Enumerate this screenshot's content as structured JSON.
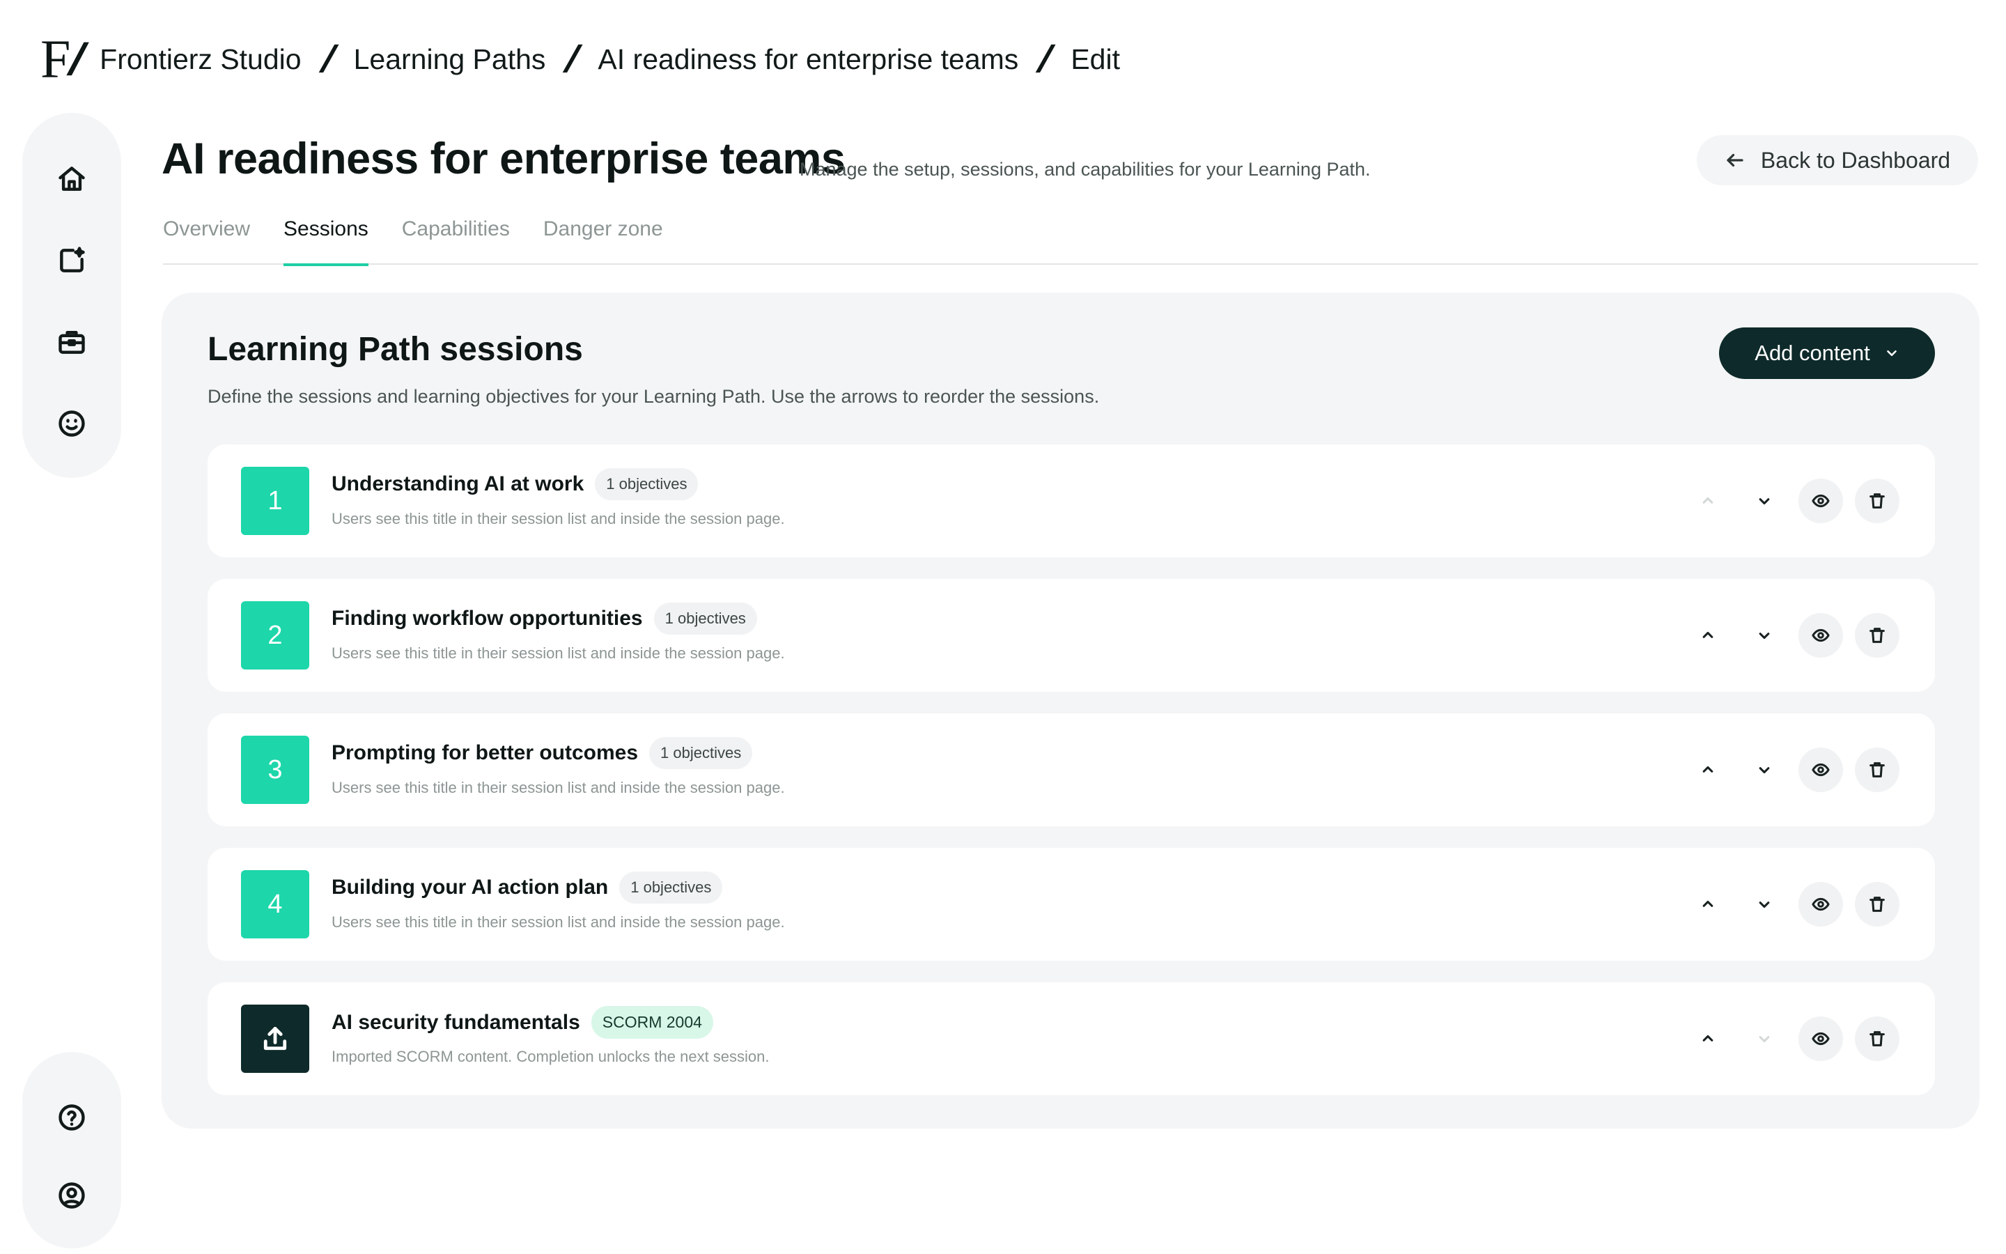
{
  "breadcrumb": {
    "logo": "F",
    "items": [
      "Frontierz Studio",
      "Learning Paths",
      "AI readiness for enterprise teams",
      "Edit"
    ]
  },
  "sidebar": {
    "top_icons": [
      "home-icon",
      "sparkle-add-icon",
      "briefcase-icon",
      "smiley-icon"
    ],
    "bottom_icons": [
      "help-icon",
      "account-icon"
    ]
  },
  "header": {
    "title": "AI readiness for enterprise teams",
    "subtitle": "Manage the setup, sessions, and capabilities for your Learning Path.",
    "back_label": "Back to Dashboard"
  },
  "tabs": [
    {
      "label": "Overview",
      "active": false
    },
    {
      "label": "Sessions",
      "active": true
    },
    {
      "label": "Capabilities",
      "active": false
    },
    {
      "label": "Danger zone",
      "active": false
    }
  ],
  "panel": {
    "title": "Learning Path sessions",
    "description": "Define the sessions and learning objectives for your Learning Path. Use the arrows to reorder the sessions.",
    "add_label": "Add content"
  },
  "sessions": [
    {
      "number": "1",
      "title": "Understanding AI at work",
      "badge": "1 objectives",
      "description": "Users see this title in their session list and inside the session page.",
      "type": "session",
      "up_enabled": false,
      "down_enabled": true
    },
    {
      "number": "2",
      "title": "Finding workflow opportunities",
      "badge": "1 objectives",
      "description": "Users see this title in their session list and inside the session page.",
      "type": "session",
      "up_enabled": true,
      "down_enabled": true
    },
    {
      "number": "3",
      "title": "Prompting for better outcomes",
      "badge": "1 objectives",
      "description": "Users see this title in their session list and inside the session page.",
      "type": "session",
      "up_enabled": true,
      "down_enabled": true
    },
    {
      "number": "4",
      "title": "Building your AI action plan",
      "badge": "1 objectives",
      "description": "Users see this title in their session list and inside the session page.",
      "type": "session",
      "up_enabled": true,
      "down_enabled": true
    },
    {
      "number": "",
      "title": "AI security fundamentals",
      "badge": "SCORM 2004",
      "description": "Imported SCORM content. Completion unlocks the next session.",
      "type": "scorm",
      "up_enabled": true,
      "down_enabled": false
    }
  ],
  "colors": {
    "accent": "#1dd6aa",
    "dark": "#0e2a2a",
    "panel_bg": "#f4f5f6",
    "scorm_badge": "#d8f7e8"
  }
}
